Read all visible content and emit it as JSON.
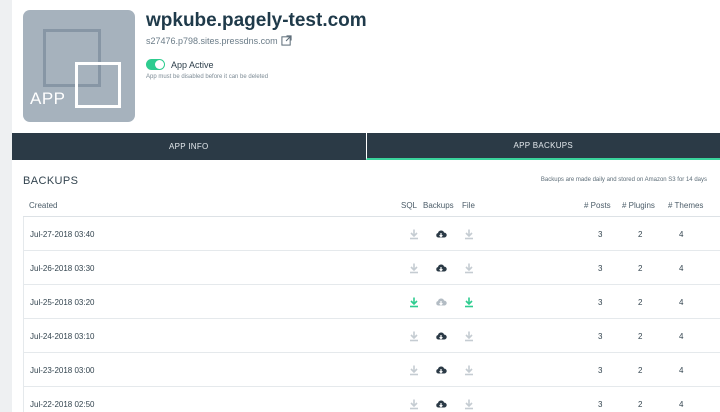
{
  "app": {
    "tile_label": "APP",
    "name": "wpkube.pagely-test.com",
    "host": "s27476.p798.sites.pressdns.com",
    "status_label": "App Active",
    "status_note": "App must be disabled before it can be deleted"
  },
  "tabs": [
    {
      "label": "APP INFO",
      "active": false
    },
    {
      "label": "APP BACKUPS",
      "active": true
    }
  ],
  "backups": {
    "title": "BACKUPS",
    "note": "Backups are made daily and stored on Amazon S3 for 14 days",
    "columns": {
      "created": "Created",
      "sql": "SQL",
      "backups": "Backups",
      "file": "File",
      "posts": "# Posts",
      "plugins": "# Plugins",
      "themes": "# Themes"
    },
    "rows": [
      {
        "created": "Jul-27-2018 03:40",
        "posts": "3",
        "plugins": "2",
        "themes": "4",
        "highlighted": false
      },
      {
        "created": "Jul-26-2018 03:30",
        "posts": "3",
        "plugins": "2",
        "themes": "4",
        "highlighted": false
      },
      {
        "created": "Jul-25-2018 03:20",
        "posts": "3",
        "plugins": "2",
        "themes": "4",
        "highlighted": true
      },
      {
        "created": "Jul-24-2018 03:10",
        "posts": "3",
        "plugins": "2",
        "themes": "4",
        "highlighted": false
      },
      {
        "created": "Jul-23-2018 03:00",
        "posts": "3",
        "plugins": "2",
        "themes": "4",
        "highlighted": false
      },
      {
        "created": "Jul-22-2018 02:50",
        "posts": "3",
        "plugins": "2",
        "themes": "4",
        "highlighted": false
      }
    ]
  },
  "icons": {
    "external_link": "external-link-icon",
    "sql_download": "download-icon",
    "backup_cloud": "cloud-download-icon",
    "file_download": "download-icon"
  },
  "colors": {
    "accent_green": "#2ecc8f",
    "tab_bg": "#2b3a46",
    "title": "#1f3a4a",
    "icon_inactive": "#c5ccd2",
    "icon_dark": "#2b3a46"
  }
}
